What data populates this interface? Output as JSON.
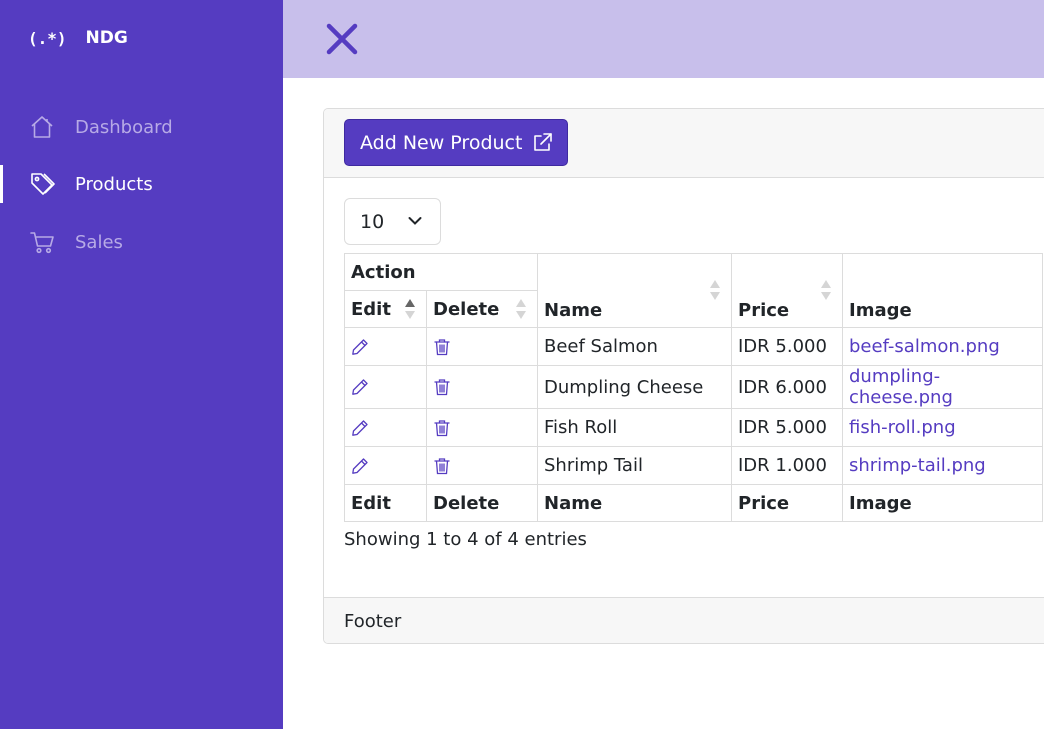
{
  "brand": {
    "logo": "(.*)",
    "name": "NDG"
  },
  "sidebar": {
    "items": [
      {
        "label": "Dashboard",
        "icon": "home-icon",
        "active": false
      },
      {
        "label": "Products",
        "icon": "tags-icon",
        "active": true
      },
      {
        "label": "Sales",
        "icon": "cart-icon",
        "active": false
      }
    ]
  },
  "header": {
    "close_icon": "close-icon"
  },
  "card": {
    "add_button_label": "Add New Product",
    "page_length": "10",
    "table": {
      "group_header": "Action",
      "columns": [
        "Edit",
        "Delete",
        "Name",
        "Price",
        "Image"
      ],
      "rows": [
        {
          "name": "Beef Salmon",
          "price": "IDR 5.000",
          "image": "beef-salmon.png"
        },
        {
          "name": "Dumpling Cheese",
          "price": "IDR 6.000",
          "image": "dumpling-cheese.png"
        },
        {
          "name": "Fish Roll",
          "price": "IDR 5.000",
          "image": "fish-roll.png"
        },
        {
          "name": "Shrimp Tail",
          "price": "IDR 1.000",
          "image": "shrimp-tail.png"
        }
      ],
      "footer_columns": [
        "Edit",
        "Delete",
        "Name",
        "Price",
        "Image"
      ]
    },
    "info": "Showing 1 to 4 of 4 entries",
    "footer": "Footer"
  },
  "colors": {
    "primary": "#553cc1",
    "topbar": "#c8bfeb",
    "nav_inactive": "#b7aae6"
  }
}
